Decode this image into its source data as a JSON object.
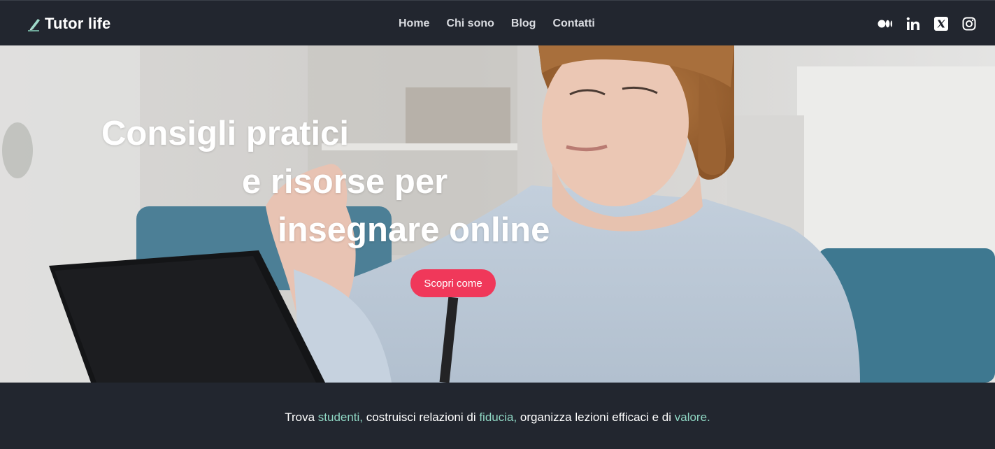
{
  "nav": {
    "brand": "Tutor life",
    "brand_icon": "pencil-icon",
    "links": [
      "Home",
      "Chi sono",
      "Blog",
      "Contatti"
    ],
    "socials": [
      "medium-icon",
      "linkedin-icon",
      "x-icon",
      "instagram-icon"
    ]
  },
  "hero": {
    "headline": [
      "Consigli pratici",
      "e risorse per",
      "insegnare online"
    ],
    "cta_label": "Scopri come",
    "cta_color": "#f0385a"
  },
  "tagline": {
    "parts": [
      "Trova ",
      "studenti,",
      " costruisci relazioni di ",
      "fiducia,",
      " organizza lezioni efficaci e di ",
      "valore."
    ],
    "accent_color": "#8fd7c4"
  },
  "theme": {
    "nav_bg": "#22262f"
  }
}
